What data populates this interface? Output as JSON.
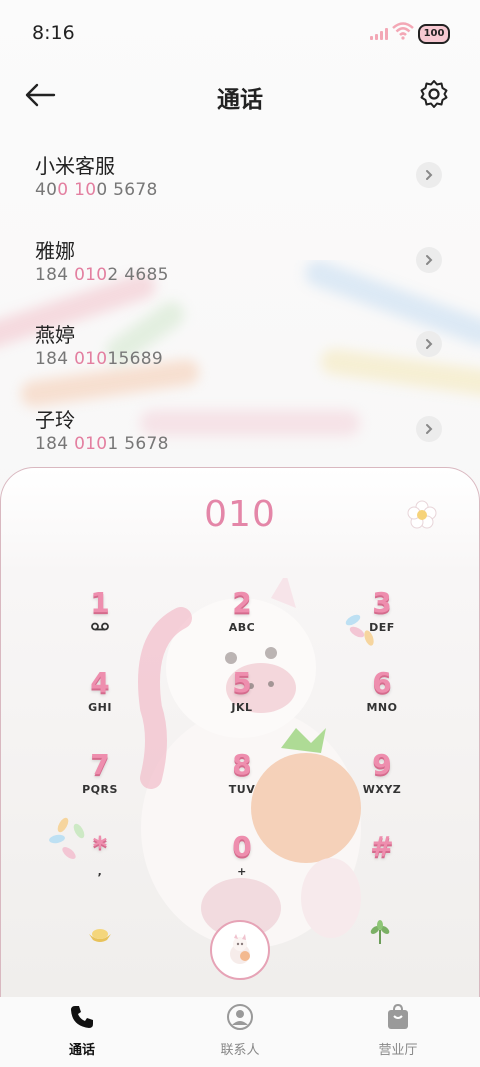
{
  "status_bar": {
    "time": "8:16",
    "battery": "100"
  },
  "header": {
    "title": "通话"
  },
  "contacts": [
    {
      "name": "小米客服",
      "num_a": "40",
      "num_hl1": "0",
      "num_b": " ",
      "num_hl2": "10",
      "num_c": "0 5678"
    },
    {
      "name": "雅娜",
      "num_a": "184 ",
      "num_hl1": "010",
      "num_b": "2 4685",
      "num_hl2": "",
      "num_c": ""
    },
    {
      "name": "燕婷",
      "num_a": "184 ",
      "num_hl1": "010",
      "num_b": "15689",
      "num_hl2": "",
      "num_c": ""
    },
    {
      "name": "子玲",
      "num_a": "184 ",
      "num_hl1": "010",
      "num_b": "1 5678",
      "num_hl2": "",
      "num_c": ""
    }
  ],
  "dialer": {
    "number": "010",
    "keys": [
      {
        "digit": "1",
        "letters": ""
      },
      {
        "digit": "2",
        "letters": "ABC"
      },
      {
        "digit": "3",
        "letters": "DEF"
      },
      {
        "digit": "4",
        "letters": "GHI"
      },
      {
        "digit": "5",
        "letters": "JKL"
      },
      {
        "digit": "6",
        "letters": "MNO"
      },
      {
        "digit": "7",
        "letters": "PQRS"
      },
      {
        "digit": "8",
        "letters": "TUV"
      },
      {
        "digit": "9",
        "letters": "WXYZ"
      },
      {
        "digit": "*",
        "letters": ","
      },
      {
        "digit": "0",
        "letters": "+"
      },
      {
        "digit": "#",
        "letters": ""
      }
    ]
  },
  "nav": {
    "items": [
      {
        "label": "通话",
        "icon": "phone-icon"
      },
      {
        "label": "联系人",
        "icon": "person-icon"
      },
      {
        "label": "营业厅",
        "icon": "shopping-bag-icon"
      }
    ]
  },
  "colors": {
    "accent": "#e486a8",
    "text": "#222222",
    "muted": "#777777"
  }
}
